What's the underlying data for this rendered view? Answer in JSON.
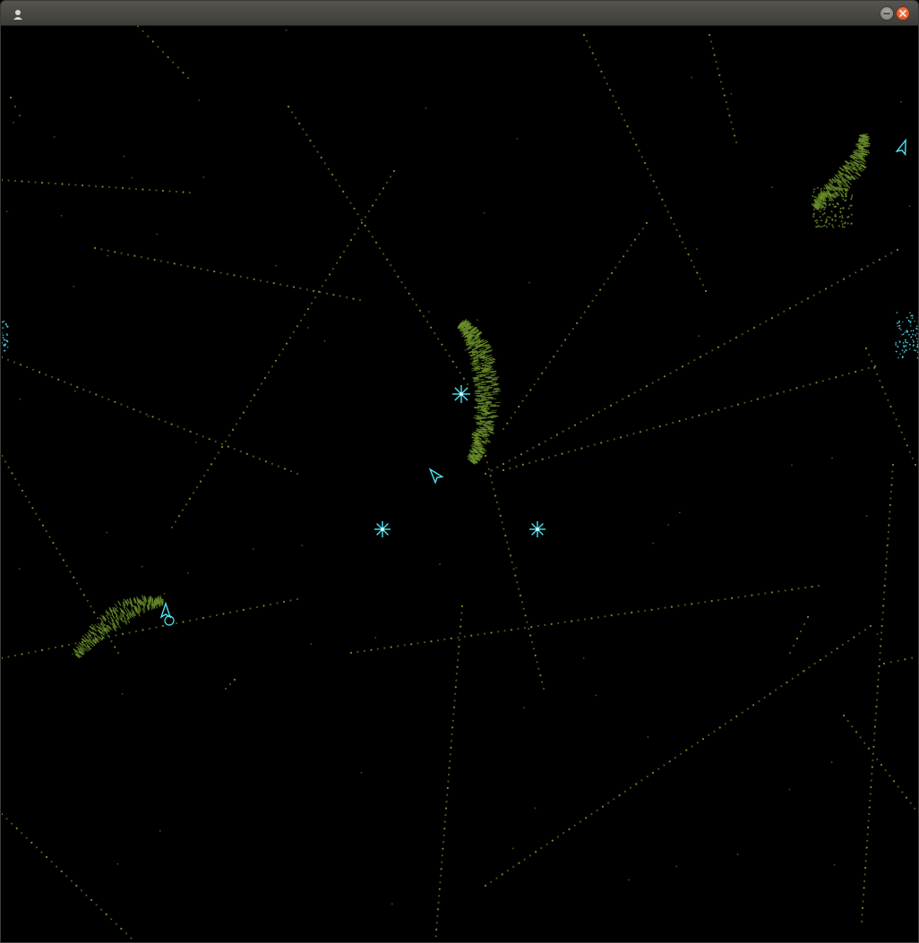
{
  "window": {
    "title": "",
    "app_icon": "app-icon",
    "minimize_icon": "minimize-icon",
    "close_icon": "close-icon"
  },
  "game": {
    "colors": {
      "background": "#000000",
      "trail_dim": "#3f5a1a",
      "trail_bright": "#6a8f2a",
      "particle_cyan": "#4fe3f0",
      "titlebar": "#4a4945",
      "close_button": "#e05a2b"
    },
    "sprites": [
      "star-burst",
      "star-burst",
      "star-burst",
      "ship",
      "ship",
      "ship",
      "ship"
    ]
  }
}
